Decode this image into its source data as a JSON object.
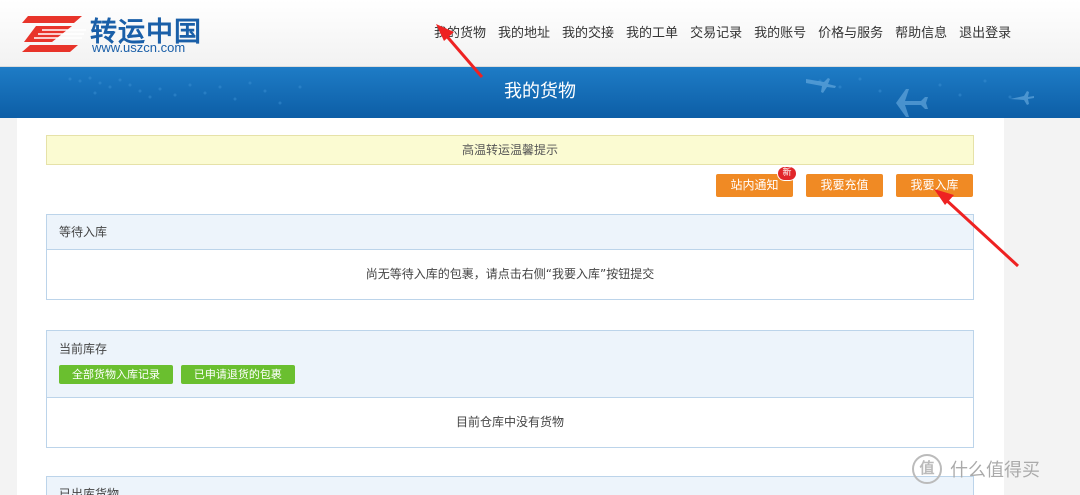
{
  "header": {
    "logo_name": "转运中国",
    "logo_url": "www.uszcn.com",
    "nav": [
      "我的货物",
      "我的地址",
      "我的交接",
      "我的工单",
      "交易记录",
      "我的账号",
      "价格与服务",
      "帮助信息",
      "退出登录"
    ]
  },
  "banner": {
    "title": "我的货物"
  },
  "notice": {
    "text": "高温转运温馨提示"
  },
  "actions": {
    "site_notice": "站内通知",
    "new_badge": "新",
    "recharge": "我要充值",
    "check_in": "我要入库"
  },
  "pending": {
    "title": "等待入库",
    "empty_text": "尚无等待入库的包裹，请点击右侧“我要入库”按钮提交"
  },
  "inventory": {
    "title": "当前库存",
    "btn_all_records": "全部货物入库记录",
    "btn_returned": "已申请退货的包裹",
    "empty_text": "目前仓库中没有货物"
  },
  "shipped": {
    "title": "已出库货物"
  },
  "watermark": {
    "icon": "值",
    "text": "什么值得买"
  },
  "colors": {
    "banner": "#1570b8",
    "orange": "#f08a24",
    "green": "#6abf2f",
    "arrow": "#ee2222"
  }
}
